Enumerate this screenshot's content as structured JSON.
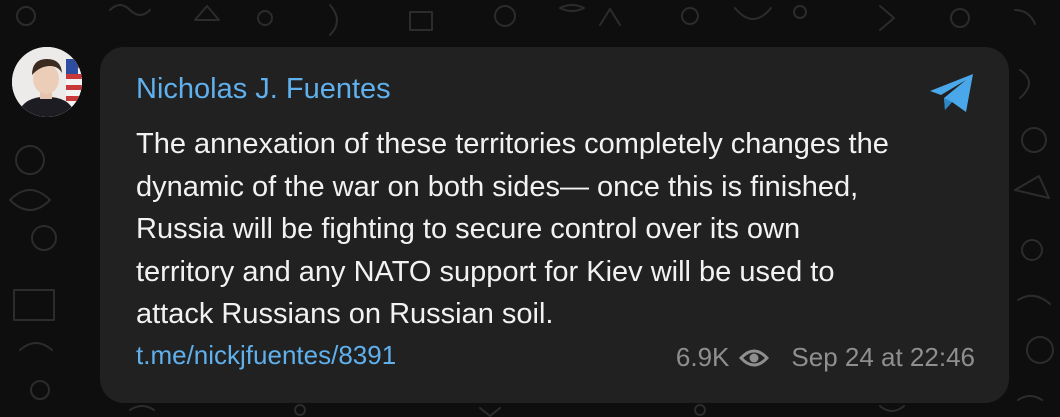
{
  "post": {
    "sender": "Nicholas J. Fuentes",
    "message_lines": [
      "The annexation of these territories completely changes the",
      "dynamic of the war on both sides— once this is finished,",
      "Russia will be fighting to secure control over its own",
      "territory and any NATO support for Kiev will be used to",
      "attack Russians on Russian soil."
    ],
    "link": "t.me/nickjfuentes/8391",
    "views": "6.9K",
    "timestamp": "Sep 24 at 22:46"
  },
  "icons": {
    "share": "telegram-share-icon",
    "views": "eye-icon"
  },
  "colors": {
    "background": "#0e0e0e",
    "bubble": "#212121",
    "accent": "#5fb0ec",
    "text": "#f2f2f2",
    "meta": "#8f8f8f"
  }
}
